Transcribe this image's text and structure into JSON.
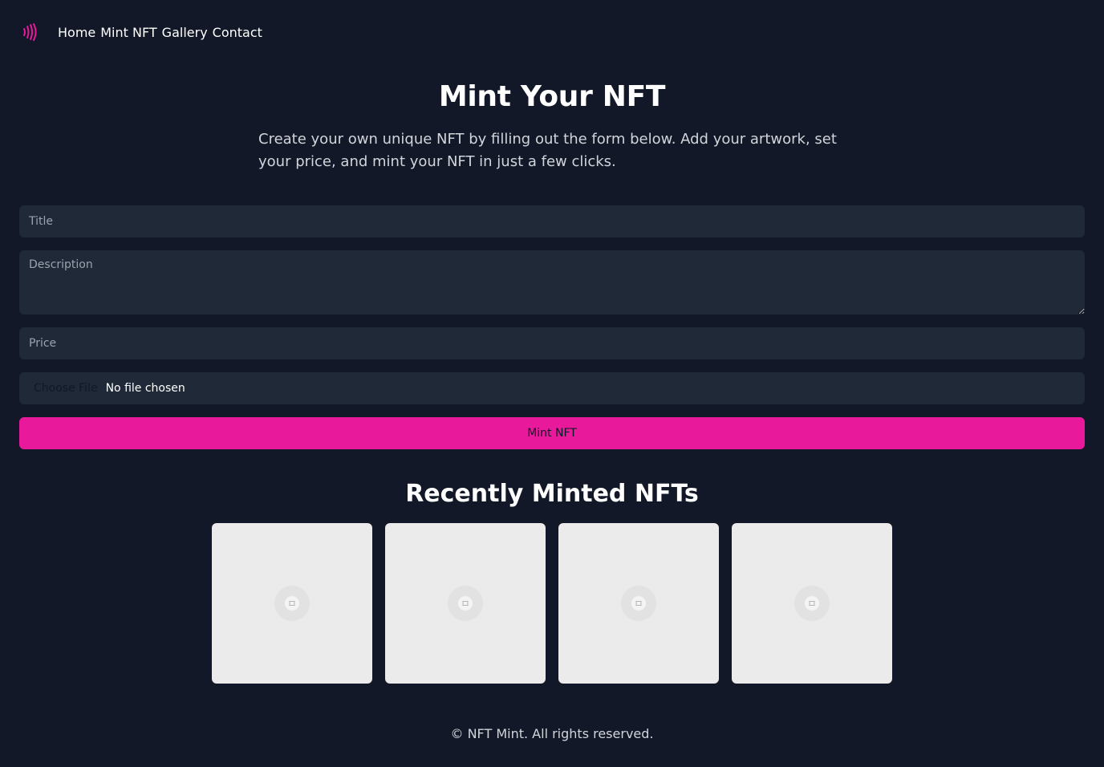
{
  "nav": {
    "logo_icon": "sound-waves-icon",
    "links": [
      {
        "label": "Home"
      },
      {
        "label": "Mint NFT"
      },
      {
        "label": "Gallery"
      },
      {
        "label": "Contact"
      }
    ]
  },
  "hero": {
    "title": "Mint Your NFT",
    "description": "Create your own unique NFT by filling out the form below. Add your artwork, set your price, and mint your NFT in just a few clicks."
  },
  "form": {
    "title_placeholder": "Title",
    "description_placeholder": "Description",
    "price_placeholder": "Price",
    "file_button": "Choose File",
    "file_status": "No file chosen",
    "submit_label": "Mint NFT"
  },
  "recent": {
    "title": "Recently Minted NFTs",
    "items": [
      {
        "icon": "image-placeholder-icon"
      },
      {
        "icon": "image-placeholder-icon"
      },
      {
        "icon": "image-placeholder-icon"
      },
      {
        "icon": "image-placeholder-icon"
      }
    ]
  },
  "footer": {
    "text": "© NFT Mint. All rights reserved."
  },
  "colors": {
    "background": "#121827",
    "field": "#1f2937",
    "accent": "#e8199b",
    "card": "#ebebeb"
  }
}
